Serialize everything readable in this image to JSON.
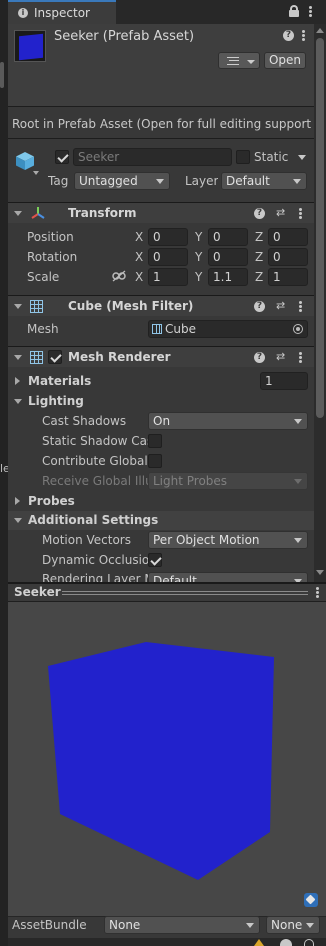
{
  "tab": {
    "title": "Inspector"
  },
  "asset": {
    "name": "Seeker (Prefab Asset)",
    "open_label": "Open"
  },
  "notice": "Root in Prefab Asset (Open for full editing support)",
  "gameobject": {
    "name_placeholder": "Seeker",
    "static_label": "Static",
    "tag_label": "Tag",
    "tag_value": "Untagged",
    "layer_label": "Layer",
    "layer_value": "Default"
  },
  "transform": {
    "title": "Transform",
    "rows": [
      {
        "label": "Position",
        "x": "0",
        "y": "0",
        "z": "0"
      },
      {
        "label": "Rotation",
        "x": "0",
        "y": "0",
        "z": "0"
      },
      {
        "label": "Scale",
        "x": "1",
        "y": "1.1",
        "z": "1"
      }
    ],
    "axes": [
      "X",
      "Y",
      "Z"
    ]
  },
  "mesh_filter": {
    "title": "Cube (Mesh Filter)",
    "mesh_label": "Mesh",
    "mesh_value": "Cube"
  },
  "mesh_renderer": {
    "title": "Mesh Renderer",
    "materials_label": "Materials",
    "materials_count": "1",
    "lighting_label": "Lighting",
    "cast_shadows_label": "Cast Shadows",
    "cast_shadows_value": "On",
    "static_shadow_label": "Static Shadow Cas",
    "contribute_gi_label": "Contribute Global",
    "receive_gi_label": "Receive Global Illu",
    "receive_gi_value": "Light Probes",
    "probes_label": "Probes",
    "additional_label": "Additional Settings",
    "motion_vectors_label": "Motion Vectors",
    "motion_vectors_value": "Per Object Motion",
    "dynamic_occlusion_label": "Dynamic Occlusio",
    "rendering_layer_label": "Rendering Layer M",
    "rendering_layer_value": "Default"
  },
  "preview": {
    "title": "Seeker",
    "cube_color": "#2020cc"
  },
  "footer": {
    "assetbundle_label": "AssetBundle",
    "bundle_value": "None",
    "variant_value": "None"
  },
  "colors": {
    "accent": "#2222cc",
    "panel": "#383838",
    "header": "#3e3e3e"
  }
}
